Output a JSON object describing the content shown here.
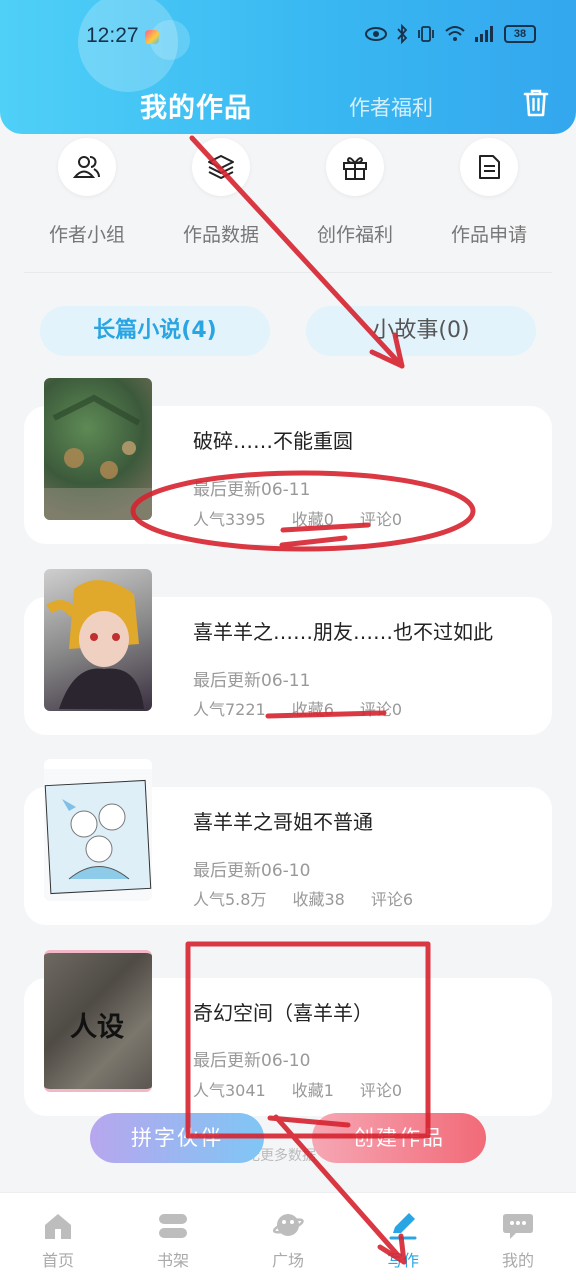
{
  "status_bar": {
    "time": "12:27",
    "battery": "38"
  },
  "header": {
    "tab_main": "我的作品",
    "tab_side": "作者福利",
    "trash_icon": "trash-icon"
  },
  "quick_actions": [
    {
      "label": "作者小组",
      "icon": "group-icon"
    },
    {
      "label": "作品数据",
      "icon": "layers-icon"
    },
    {
      "label": "创作福利",
      "icon": "gift-icon"
    },
    {
      "label": "作品申请",
      "icon": "document-icon"
    }
  ],
  "segments": {
    "novels": "长篇小说(4)",
    "stories": "小故事(0)"
  },
  "works": [
    {
      "title": "破碎……不能重圆",
      "updated": "最后更新06-11",
      "popularity": "人气3395",
      "favorites": "收藏0",
      "comments": "评论0"
    },
    {
      "title": "喜羊羊之……朋友……也不过如此",
      "updated": "最后更新06-11",
      "popularity": "人气7221",
      "favorites": "收藏6",
      "comments": "评论0"
    },
    {
      "title": "喜羊羊之哥姐不普通",
      "updated": "最后更新06-10",
      "popularity": "人气5.8万",
      "favorites": "收藏38",
      "comments": "评论6"
    },
    {
      "title": "奇幻空间（喜羊羊）",
      "updated": "最后更新06-10",
      "popularity": "人气3041",
      "favorites": "收藏1",
      "comments": "评论0",
      "cover_text": "人设"
    }
  ],
  "floating": {
    "left_button": "拼字伙伴",
    "right_button": "创建作品",
    "no_more": "暂无更多数据"
  },
  "bottom_nav": [
    {
      "label": "首页",
      "icon": "home-icon"
    },
    {
      "label": "书架",
      "icon": "bookshelf-icon"
    },
    {
      "label": "广场",
      "icon": "planet-icon"
    },
    {
      "label": "写作",
      "icon": "pen-icon",
      "active": true
    },
    {
      "label": "我的",
      "icon": "chat-icon"
    }
  ],
  "colors": {
    "accent": "#2aa5e3",
    "header_gradient_start": "#4fd0f7",
    "header_gradient_end": "#34a7ee",
    "annotation_red": "#d6232f"
  }
}
